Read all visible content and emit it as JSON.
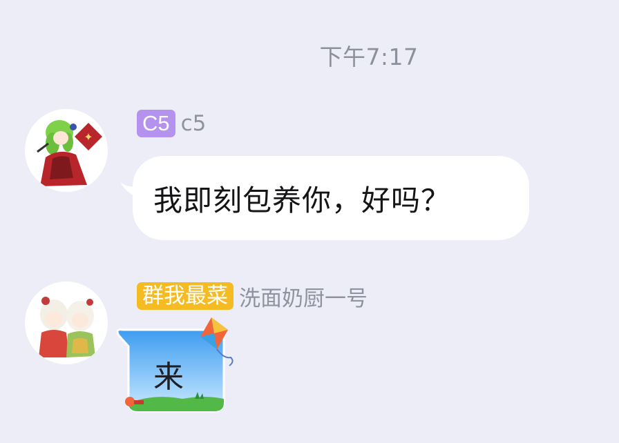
{
  "conversation": {
    "timestamp": "下午7:17",
    "messages": [
      {
        "badge": "C5",
        "badge_color": "#b592ee",
        "sender": "c5",
        "text": "我即刻包养你，好吗？",
        "avatar": "anime-avatar-green-hair"
      },
      {
        "badge": "群我最菜",
        "badge_color": "#f4bb22",
        "sender": "洗面奶厨一号",
        "text": "来",
        "avatar": "anime-avatar-two-girls",
        "bubble_style": "kite-bubble"
      }
    ]
  }
}
